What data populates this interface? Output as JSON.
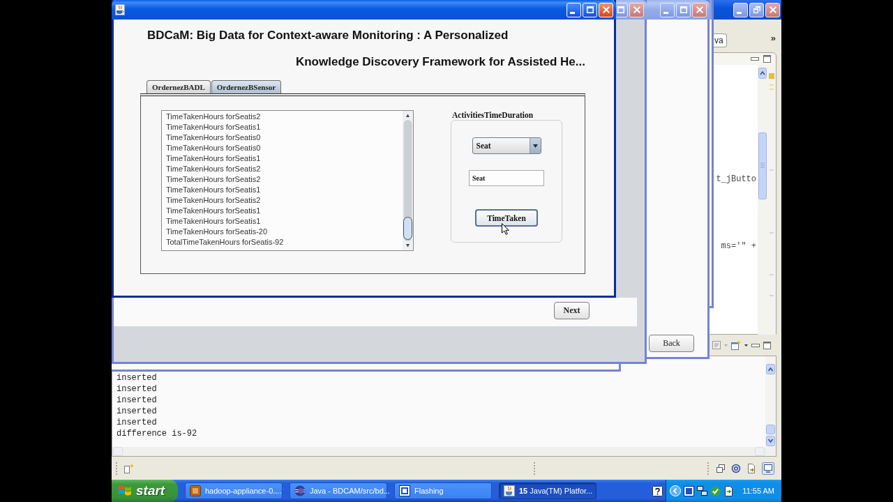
{
  "ide": {
    "editor_tab": "va",
    "overflow": "»",
    "code_lines": [
      "t_jButto",
      "ms='\" +"
    ],
    "console_lines": [
      "inserted",
      "inserted",
      "inserted",
      "inserted",
      "inserted",
      "difference is-92"
    ]
  },
  "windows": [
    {
      "kind": "dialog",
      "active": false,
      "button": "Back"
    },
    {
      "kind": "panel",
      "active": false,
      "button": "Next"
    },
    {
      "kind": "main",
      "active": true,
      "headings": [
        "BDCaM: Big Data for Context-aware Monitoring : A Personalized",
        "Knowledge Discovery Framework for Assisted He..."
      ],
      "tabs": [
        {
          "label": "OrdernezBADL",
          "selected": false
        },
        {
          "label": "OrdernezBSensor",
          "selected": true
        }
      ],
      "list_items": [
        "TimeTakenHours forSeatis2",
        "TimeTakenHours forSeatis1",
        "TimeTakenHours forSeatis0",
        "TimeTakenHours forSeatis0",
        "TimeTakenHours forSeatis1",
        "TimeTakenHours forSeatis2",
        "TimeTakenHours forSeatis2",
        "TimeTakenHours forSeatis1",
        "TimeTakenHours forSeatis2",
        "TimeTakenHours forSeatis1",
        "TimeTakenHours forSeatis1",
        "TimeTakenHours forSeatis-20",
        "TotalTimeTakenHours forSeatis-92"
      ],
      "group": {
        "title": "ActivitiesTimeDuration",
        "dropdown": "Seat",
        "field": "Seat",
        "button": "TimeTaken"
      }
    }
  ],
  "taskbar": {
    "start": "start",
    "items": [
      {
        "label": "hadoop-appliance-0....",
        "selected": false
      },
      {
        "label": "Java - BDCAM/src/bd...",
        "selected": false
      },
      {
        "label": "Flashing",
        "selected": false
      },
      {
        "count": "15",
        "label": "Java(TM) Platfor...",
        "selected": true
      }
    ],
    "clock": "11:55 AM"
  }
}
